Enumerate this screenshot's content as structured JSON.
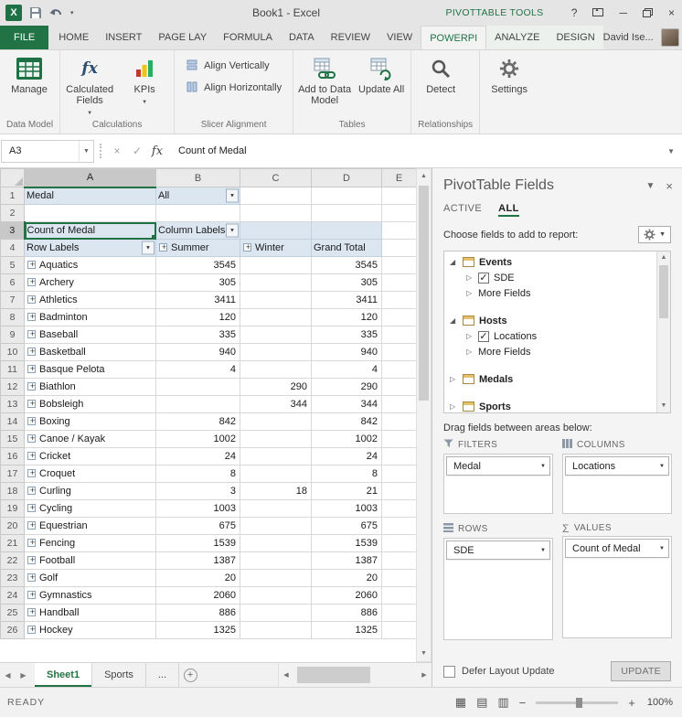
{
  "colors": {
    "accent_green": "#217346",
    "pivot_header_blue": "#DCE6F1",
    "file_tab_green": "#217346",
    "smiley_yellow": "#F0B400"
  },
  "titlebar": {
    "title": "Book1 - Excel",
    "contextual_title": "PIVOTTABLE TOOLS",
    "help": "?"
  },
  "ribbon": {
    "file": "FILE",
    "tabs": [
      {
        "label": "HOME"
      },
      {
        "label": "INSERT"
      },
      {
        "label": "PAGE LAY"
      },
      {
        "label": "FORMULA"
      },
      {
        "label": "DATA"
      },
      {
        "label": "REVIEW"
      },
      {
        "label": "VIEW"
      },
      {
        "label": "POWERPI",
        "active": true
      }
    ],
    "contextual_tabs": [
      {
        "label": "ANALYZE"
      },
      {
        "label": "DESIGN"
      }
    ],
    "user_name": "David Ise...",
    "buttons": {
      "manage": "Manage",
      "calculated_fields": "Calculated Fields",
      "kpis": "KPIs",
      "align_vertically": "Align Vertically",
      "align_horizontally": "Align Horizontally",
      "add_to_data_model": "Add to Data Model",
      "update_all": "Update All",
      "detect": "Detect",
      "settings": "Settings"
    },
    "group_labels": [
      "Data Model",
      "Calculations",
      "Slicer Alignment",
      "Tables",
      "Relationships"
    ]
  },
  "formula_bar": {
    "name_box": "A3",
    "fx_label": "fx",
    "value": "Count of Medal"
  },
  "grid": {
    "col_headers": [
      "A",
      "B",
      "C",
      "D",
      "E"
    ],
    "selected_col": "A",
    "selected_cell": "A3",
    "row_nums": [
      "1",
      "2",
      "3",
      "4"
    ],
    "filter_label": "Medal",
    "filter_value": "All",
    "pivot_title": "Count of Medal",
    "column_labels": "Column Labels",
    "row_labels": "Row Labels",
    "summer_label": "Summer",
    "winter_label": "Winter",
    "grand_total_label": "Grand Total",
    "rows": [
      {
        "num": "5",
        "name": "Aquatics",
        "summer": "3545",
        "winter": "",
        "total": "3545"
      },
      {
        "num": "6",
        "name": "Archery",
        "summer": "305",
        "winter": "",
        "total": "305"
      },
      {
        "num": "7",
        "name": "Athletics",
        "summer": "3411",
        "winter": "",
        "total": "3411"
      },
      {
        "num": "8",
        "name": "Badminton",
        "summer": "120",
        "winter": "",
        "total": "120"
      },
      {
        "num": "9",
        "name": "Baseball",
        "summer": "335",
        "winter": "",
        "total": "335"
      },
      {
        "num": "10",
        "name": "Basketball",
        "summer": "940",
        "winter": "",
        "total": "940"
      },
      {
        "num": "11",
        "name": "Basque Pelota",
        "summer": "4",
        "winter": "",
        "total": "4"
      },
      {
        "num": "12",
        "name": "Biathlon",
        "summer": "",
        "winter": "290",
        "total": "290"
      },
      {
        "num": "13",
        "name": "Bobsleigh",
        "summer": "",
        "winter": "344",
        "total": "344"
      },
      {
        "num": "14",
        "name": "Boxing",
        "summer": "842",
        "winter": "",
        "total": "842"
      },
      {
        "num": "15",
        "name": "Canoe / Kayak",
        "summer": "1002",
        "winter": "",
        "total": "1002"
      },
      {
        "num": "16",
        "name": "Cricket",
        "summer": "24",
        "winter": "",
        "total": "24"
      },
      {
        "num": "17",
        "name": "Croquet",
        "summer": "8",
        "winter": "",
        "total": "8"
      },
      {
        "num": "18",
        "name": "Curling",
        "summer": "3",
        "winter": "18",
        "total": "21"
      },
      {
        "num": "19",
        "name": "Cycling",
        "summer": "1003",
        "winter": "",
        "total": "1003"
      },
      {
        "num": "20",
        "name": "Equestrian",
        "summer": "675",
        "winter": "",
        "total": "675"
      },
      {
        "num": "21",
        "name": "Fencing",
        "summer": "1539",
        "winter": "",
        "total": "1539"
      },
      {
        "num": "22",
        "name": "Football",
        "summer": "1387",
        "winter": "",
        "total": "1387"
      },
      {
        "num": "23",
        "name": "Golf",
        "summer": "20",
        "winter": "",
        "total": "20"
      },
      {
        "num": "24",
        "name": "Gymnastics",
        "summer": "2060",
        "winter": "",
        "total": "2060"
      },
      {
        "num": "25",
        "name": "Handball",
        "summer": "886",
        "winter": "",
        "total": "886"
      },
      {
        "num": "26",
        "name": "Hockey",
        "summer": "1325",
        "winter": "",
        "total": "1325"
      }
    ]
  },
  "fields_pane": {
    "title": "PivotTable Fields",
    "tabs": [
      {
        "label": "ACTIVE"
      },
      {
        "label": "ALL",
        "active": true
      }
    ],
    "choose_label": "Choose fields to add to report:",
    "tree": [
      {
        "label": "Events",
        "exp": true,
        "tbl": true
      },
      {
        "label": "SDE",
        "lvl1": true,
        "col": true,
        "cb": true,
        "checked": true
      },
      {
        "label": "More Fields",
        "lvl1": true,
        "col": true
      },
      {
        "label": "Hosts",
        "exp": true,
        "tbl": true,
        "gap": true
      },
      {
        "label": "Locations",
        "lvl1": true,
        "col": true,
        "cb": true,
        "checked": true
      },
      {
        "label": "More Fields",
        "lvl1": true,
        "col": true
      },
      {
        "label": "Medals",
        "col": true,
        "tbl": true,
        "gap": true
      },
      {
        "label": "Sports",
        "col": true,
        "tbl": true,
        "gap": true
      }
    ],
    "drag_label": "Drag fields between areas below:",
    "areas": [
      {
        "name": "FILTERS",
        "fields": [
          "Medal"
        ]
      },
      {
        "name": "COLUMNS",
        "fields": [
          "Locations"
        ]
      },
      {
        "name": "ROWS",
        "fields": [
          "SDE"
        ]
      },
      {
        "name": "VALUES",
        "fields": [
          "Count of Medal"
        ]
      }
    ],
    "defer_label": "Defer Layout Update",
    "update_label": "UPDATE"
  },
  "sheet_bar": {
    "tabs": [
      {
        "label": "Sheet1",
        "active": true
      },
      {
        "label": "Sports"
      },
      {
        "label": "..."
      }
    ]
  },
  "status_bar": {
    "mode": "READY",
    "zoom": "100%"
  }
}
